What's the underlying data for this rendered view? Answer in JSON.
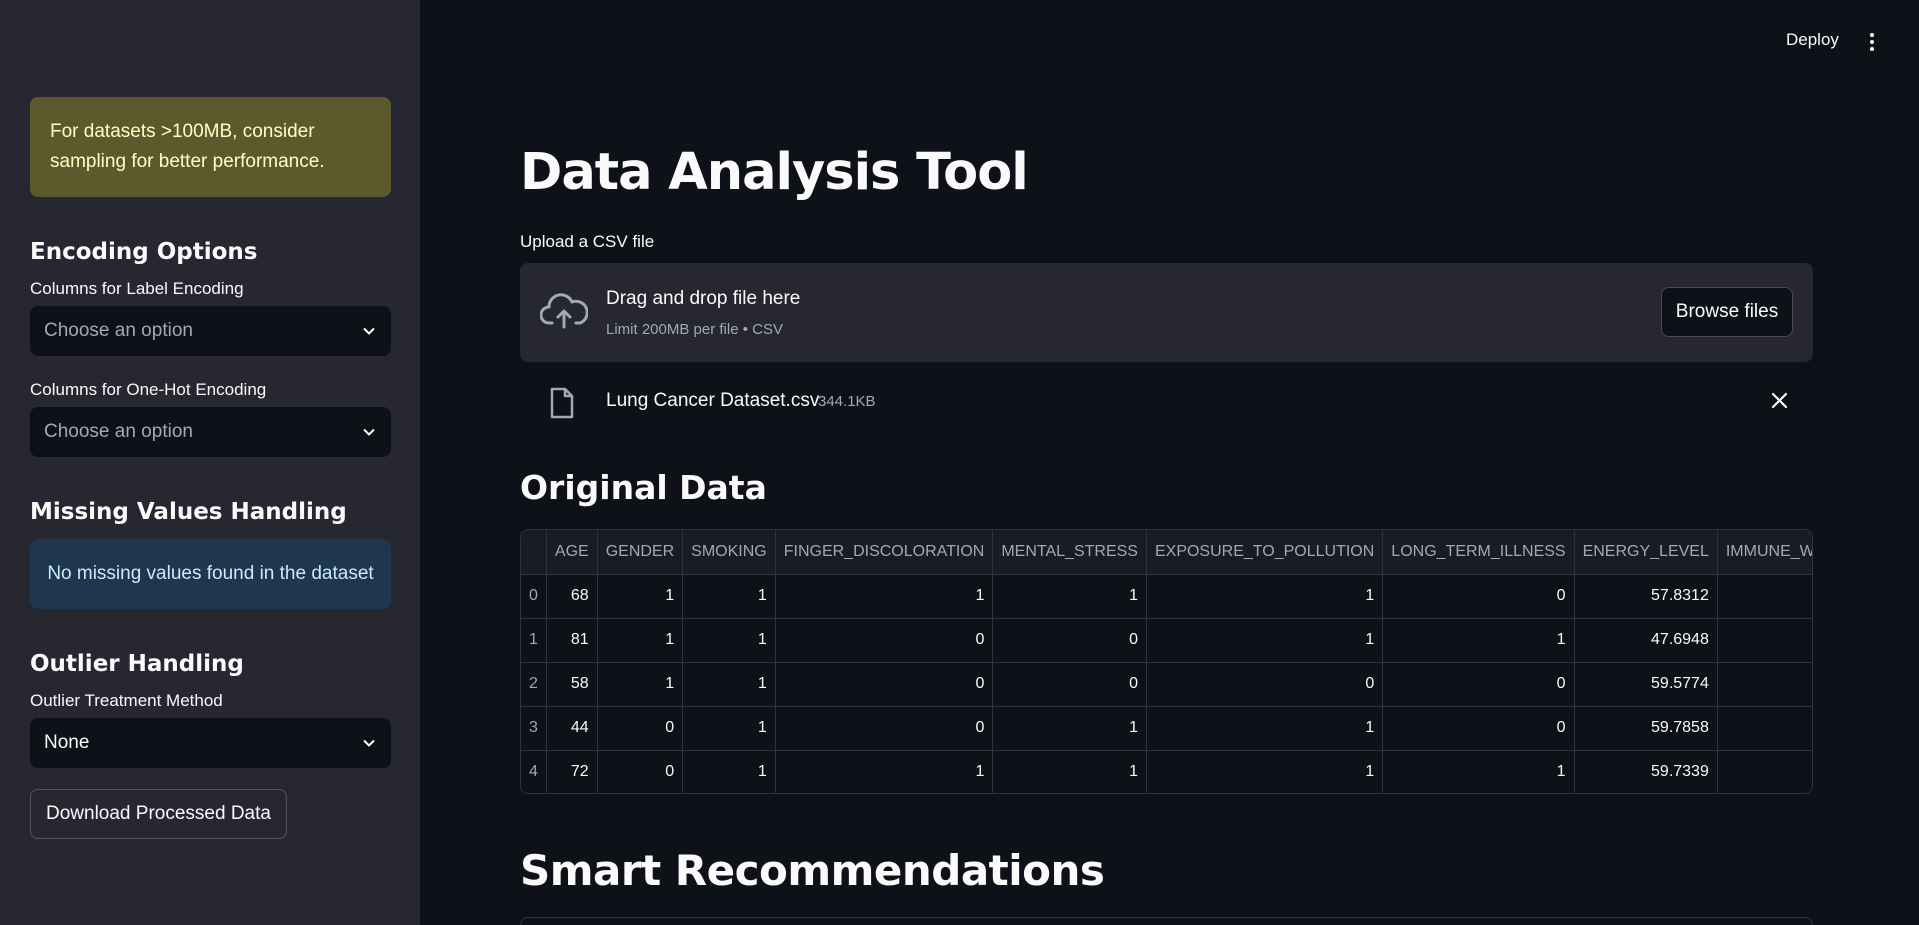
{
  "sidebar": {
    "warning": "For datasets >100MB, consider sampling for better performance.",
    "encoding_heading": "Encoding Options",
    "label_encoding_label": "Columns for Label Encoding",
    "label_encoding_placeholder": "Choose an option",
    "onehot_label": "Columns for One-Hot Encoding",
    "onehot_placeholder": "Choose an option",
    "missing_heading": "Missing Values Handling",
    "missing_info": "No missing values found in the dataset",
    "outlier_heading": "Outlier Handling",
    "outlier_method_label": "Outlier Treatment Method",
    "outlier_method_value": "None",
    "download_button": "Download Processed Data"
  },
  "header": {
    "deploy_label": "Deploy",
    "menu_icon": "kebab-menu-icon"
  },
  "main": {
    "title": "Data Analysis Tool",
    "upload_label": "Upload a CSV file",
    "dropzone_title": "Drag and drop file here",
    "dropzone_subtitle": "Limit 200MB per file • CSV",
    "browse_button": "Browse files",
    "file_name": "Lung Cancer Dataset.csv",
    "file_size": "344.1KB",
    "original_heading": "Original Data",
    "recommendations_heading": "Smart Recommendations"
  },
  "table": {
    "columns": [
      "",
      "AGE",
      "GENDER",
      "SMOKING",
      "FINGER_DISCOLORATION",
      "MENTAL_STRESS",
      "EXPOSURE_TO_POLLUTION",
      "LONG_TERM_ILLNESS",
      "ENERGY_LEVEL",
      "IMMUNE_WE"
    ],
    "rows": [
      [
        "0",
        "68",
        "1",
        "1",
        "1",
        "1",
        "1",
        "0",
        "57.8312",
        ""
      ],
      [
        "1",
        "81",
        "1",
        "1",
        "0",
        "0",
        "1",
        "1",
        "47.6948",
        ""
      ],
      [
        "2",
        "58",
        "1",
        "1",
        "0",
        "0",
        "0",
        "0",
        "59.5774",
        ""
      ],
      [
        "3",
        "44",
        "0",
        "1",
        "0",
        "1",
        "1",
        "0",
        "59.7858",
        ""
      ],
      [
        "4",
        "72",
        "0",
        "1",
        "1",
        "1",
        "1",
        "1",
        "59.7339",
        ""
      ]
    ]
  },
  "colors": {
    "sidebar_bg": "#262730",
    "main_bg": "#0e1117",
    "warning_bg": "#5c5a2c",
    "info_bg": "#1f3550"
  }
}
